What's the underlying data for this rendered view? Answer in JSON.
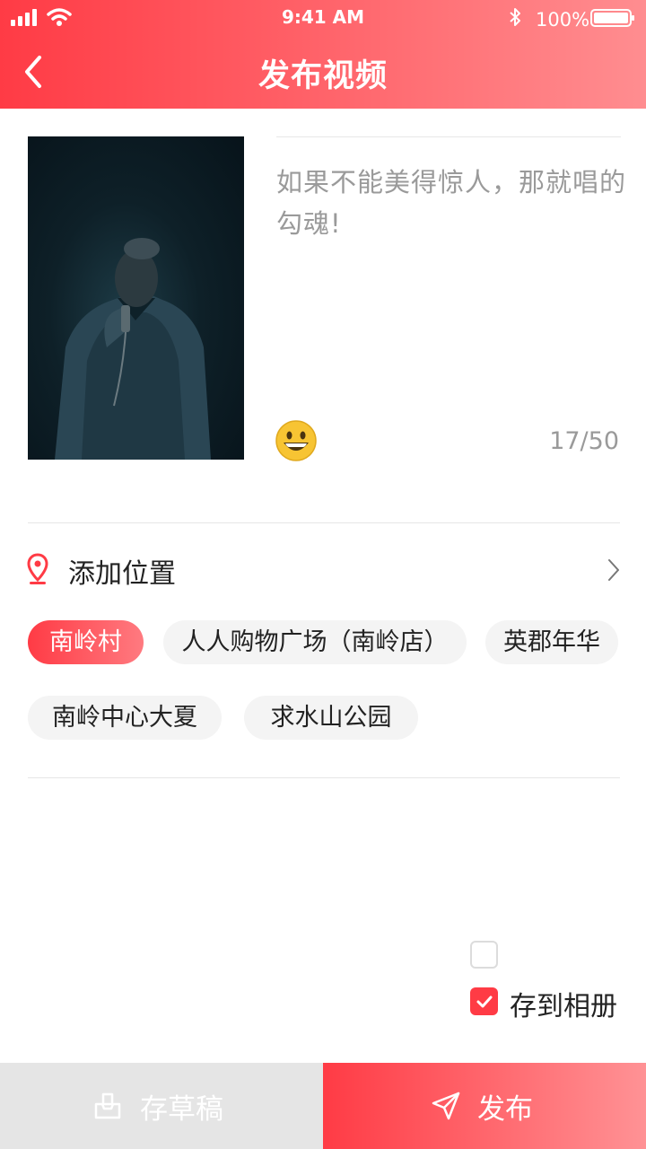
{
  "status_bar": {
    "time": "9:41 AM",
    "battery": "100%"
  },
  "header": {
    "title": "发布视频"
  },
  "post": {
    "description": "如果不能美得惊人，那就唱的勾魂!",
    "char_count": "17/50"
  },
  "location": {
    "label": "添加位置",
    "suggestions": [
      "南岭村",
      "人人购物广场（南岭店）",
      "英郡年华",
      "南岭中心大夏",
      "求水山公园"
    ],
    "selected": "南岭村"
  },
  "options": {
    "save_to_album_label": "存到相册",
    "save_to_album_checked": true
  },
  "bottom_bar": {
    "draft_label": "存草稿",
    "publish_label": "发布"
  },
  "colors": {
    "accent": "#ff3b45",
    "accent_light": "#ff8d90",
    "chip_bg": "#f4f4f4",
    "draft_bg": "#e5e5e5"
  },
  "icons": [
    "signal-icon",
    "wifi-icon",
    "bluetooth-icon",
    "battery-icon",
    "back-arrow-icon",
    "emoji-icon",
    "location-pin-icon",
    "chevron-right-icon",
    "checkbox-icon",
    "checkmark-icon",
    "draft-box-icon",
    "send-icon"
  ]
}
